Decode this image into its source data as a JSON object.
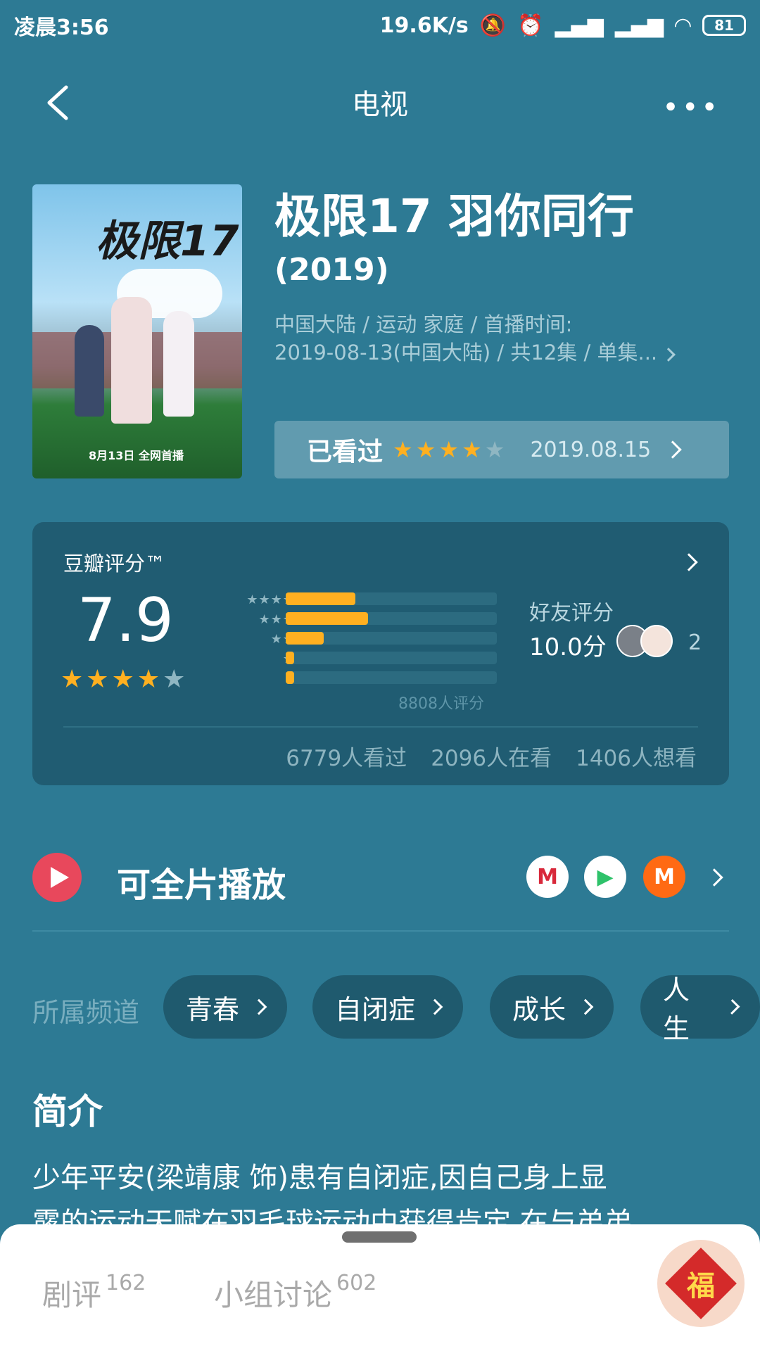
{
  "status_bar": {
    "time": "凌晨3:56",
    "net_speed": "19.6K/s",
    "battery": "81"
  },
  "nav": {
    "title": "电视"
  },
  "movie": {
    "title": "极限17 羽你同行",
    "year": "(2019)",
    "meta_line1": "中国大陆 / 运动 家庭 / 首播时间:",
    "meta_line2": "2019-08-13(中国大陆) / 共12集 / 单集...",
    "poster": {
      "title": "极限17",
      "caption": "8月13日 全网首播"
    }
  },
  "watched": {
    "label": "已看过",
    "user_rating": 4,
    "date": "2019.08.15"
  },
  "rating": {
    "label": "豆瓣评分™",
    "score": "7.9",
    "score_stars": 4,
    "distribution": [
      {
        "stars": "★★★★★",
        "fraction": 0.33
      },
      {
        "stars": "★★★★",
        "fraction": 0.39
      },
      {
        "stars": "★★★",
        "fraction": 0.18
      },
      {
        "stars": "★★",
        "fraction": 0.03
      },
      {
        "stars": "★",
        "fraction": 0.04
      }
    ],
    "raters": "8808人评分",
    "friend_label": "好友评分",
    "friend_score": "10.0分",
    "friend_count": "2",
    "counts": [
      "6779人看过",
      "2096人在看",
      "1406人想看"
    ]
  },
  "play": {
    "label": "可全片播放",
    "platforms": [
      {
        "name": "M",
        "color": "#d8283a",
        "bg": "#ffffff"
      },
      {
        "name": "▶",
        "color": "#2ec26a",
        "bg": "#ffffff"
      },
      {
        "name": "M",
        "color": "#ffffff",
        "bg": "#ff6a13"
      }
    ]
  },
  "channels": {
    "label": "所属频道",
    "tags": [
      "青春",
      "自闭症",
      "成长",
      "人生"
    ]
  },
  "intro": {
    "title": "简介",
    "line1": "少年平安(梁靖康 饰)患有自闭症,因自己身上显",
    "line2": "露的运动天赋在羽毛球运动中获得肯定,在与弟弟"
  },
  "bottom_tabs": [
    {
      "label": "剧评",
      "count": "162"
    },
    {
      "label": "小组讨论",
      "count": "602"
    }
  ],
  "fu_badge": "福",
  "colors": {
    "background": "#2d7a94",
    "card": "#205c72",
    "accent_star": "#ffb020",
    "play": "#e8485c"
  }
}
